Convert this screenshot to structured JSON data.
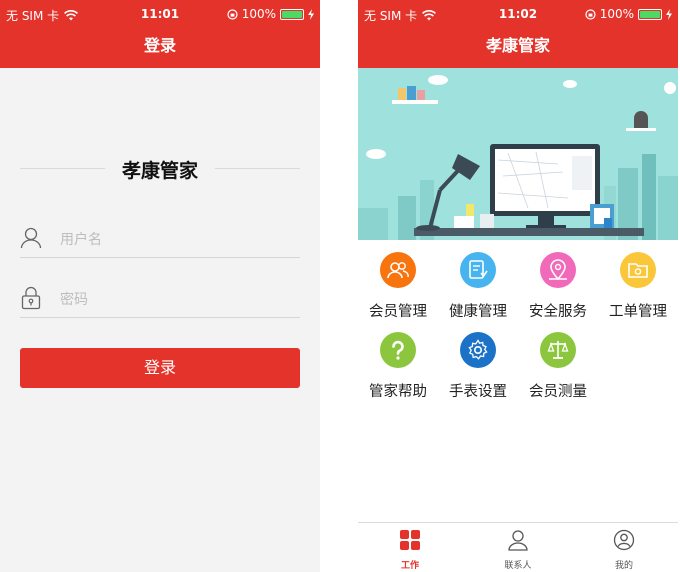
{
  "status_bar": {
    "carrier": "无 SIM 卡",
    "battery": "100%"
  },
  "login_screen": {
    "time": "11:01",
    "nav_title": "登录",
    "app_title": "孝康管家",
    "username_placeholder": "用户名",
    "password_placeholder": "密码",
    "login_button": "登录"
  },
  "home_screen": {
    "time": "11:02",
    "nav_title": "孝康管家",
    "menu": [
      {
        "label": "会员管理",
        "icon": "members-icon",
        "color": "#f7740f"
      },
      {
        "label": "健康管理",
        "icon": "health-doc-icon",
        "color": "#47b3ef"
      },
      {
        "label": "安全服务",
        "icon": "location-icon",
        "color": "#f169b9"
      },
      {
        "label": "工单管理",
        "icon": "folder-icon",
        "color": "#fbc73a"
      },
      {
        "label": "管家帮助",
        "icon": "help-icon",
        "color": "#8cc63f"
      },
      {
        "label": "手表设置",
        "icon": "settings-icon",
        "color": "#1b72c7"
      },
      {
        "label": "会员测量",
        "icon": "scale-icon",
        "color": "#8cc63f"
      }
    ],
    "tabs": [
      {
        "label": "工作",
        "icon": "grid-icon",
        "active": true
      },
      {
        "label": "联系人",
        "icon": "contacts-icon",
        "active": false
      },
      {
        "label": "我的",
        "icon": "profile-icon",
        "active": false
      }
    ]
  },
  "colors": {
    "brand": "#e4332b",
    "banner_bg": "#9fe1dc"
  }
}
